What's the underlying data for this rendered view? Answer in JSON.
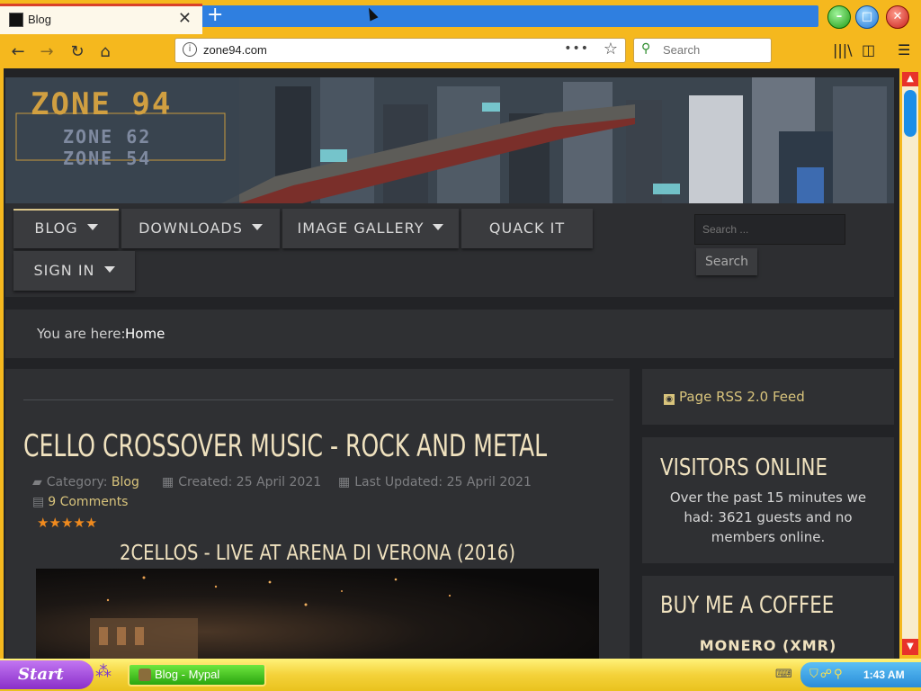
{
  "browser": {
    "tab_title": "Blog",
    "new_tab_label": "+",
    "url": "zone94.com",
    "search_placeholder": "Search"
  },
  "site": {
    "banner_logo_main": "ZONE 94",
    "banner_logo_sub1": "ZONE 62",
    "banner_logo_sub2": "ZONE 54",
    "menu": [
      {
        "label": "BLOG",
        "has_caret": true,
        "active": true
      },
      {
        "label": "DOWNLOADS",
        "has_caret": true
      },
      {
        "label": "IMAGE GALLERY",
        "has_caret": true
      },
      {
        "label": "QUACK IT",
        "has_caret": false
      },
      {
        "label": "SIGN IN",
        "has_caret": true
      }
    ],
    "search_placeholder": "Search ...",
    "search_button": "Search",
    "breadcrumb_label": "You are here:",
    "breadcrumb_home": "Home"
  },
  "article": {
    "title": "CELLO CROSSOVER MUSIC - ROCK AND METAL",
    "category_label": "Category:",
    "category_value": "Blog",
    "created": "Created: 25 April 2021",
    "updated": "Last Updated: 25 April 2021",
    "comments": "9 Comments",
    "stars": "★★★★★",
    "video_title": "2CELLOS - LIVE AT ARENA DI VERONA (2016)"
  },
  "sidebar": {
    "rss": "Page RSS 2.0 Feed",
    "visitors_title": "VISITORS ONLINE",
    "visitors_text": "Over the past 15 minutes we had: 3621 guests and no members online.",
    "coffee_title": "BUY ME A COFFEE",
    "monero": "MONERO (XMR)"
  },
  "taskbar": {
    "start": "Start",
    "task": "Blog - Mypal",
    "clock": "1:43 AM"
  }
}
